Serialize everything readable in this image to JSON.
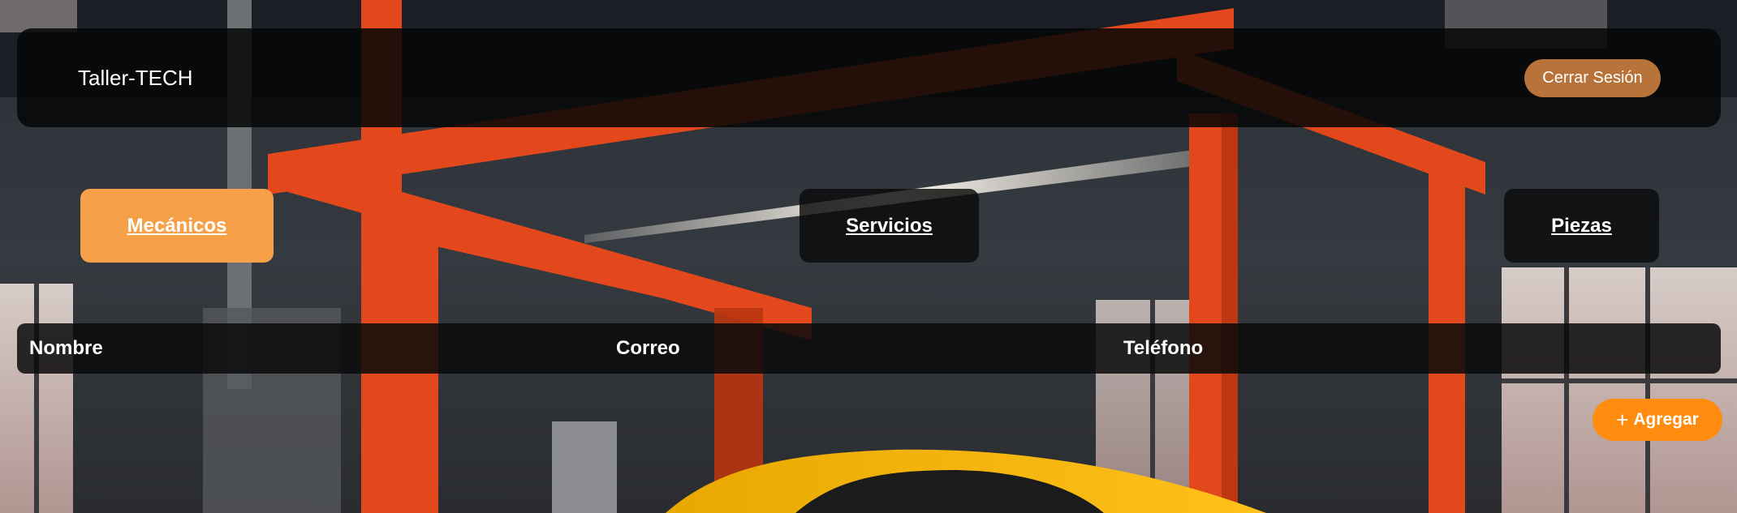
{
  "header": {
    "brand": "Taller-TECH",
    "logout_label": "Cerrar Sesión"
  },
  "tabs": [
    {
      "label": "Mecánicos",
      "active": true
    },
    {
      "label": "Servicios",
      "active": false
    },
    {
      "label": "Piezas",
      "active": false
    }
  ],
  "table": {
    "columns": [
      "Nombre",
      "Correo",
      "Teléfono"
    ],
    "rows": []
  },
  "actions": {
    "add_label": "Agregar",
    "add_icon": "plus-icon"
  },
  "colors": {
    "accent_orange": "#ff8c0f",
    "active_tab": "#f7a04a",
    "logout_button": "#b8733a",
    "panel_dark": "#0a0a0a"
  }
}
